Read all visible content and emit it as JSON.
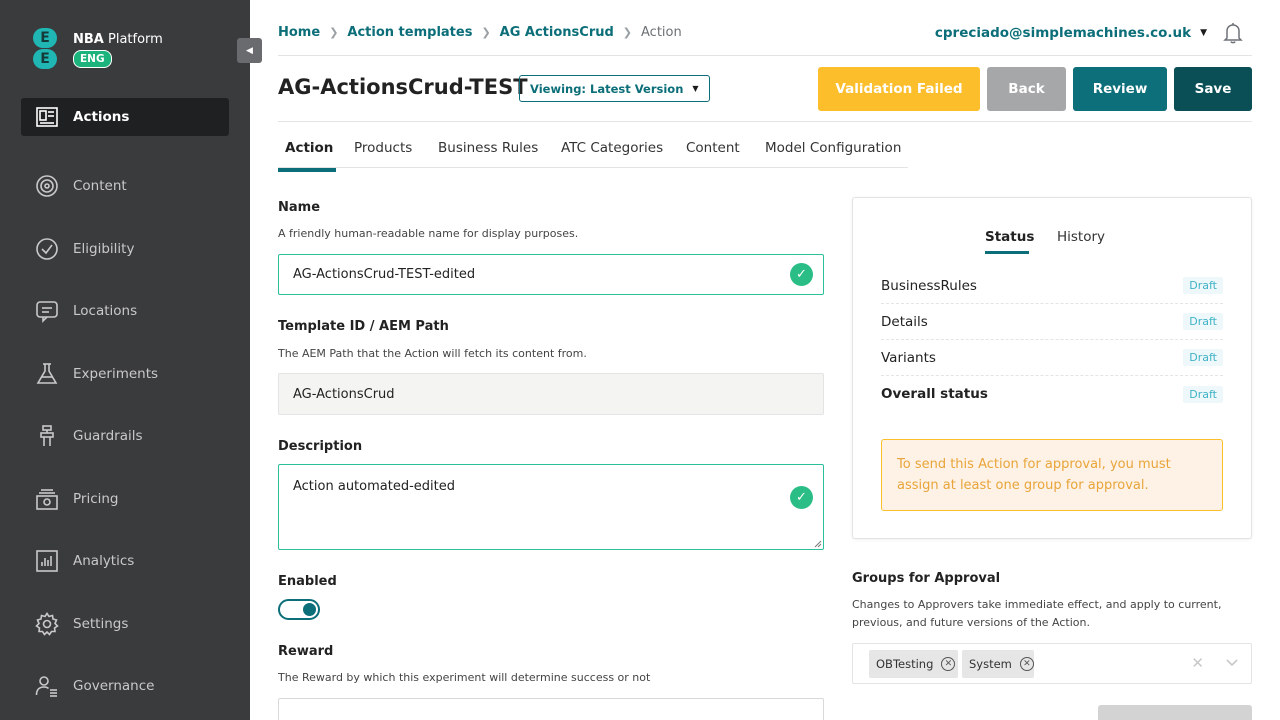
{
  "app": {
    "brand_name_bold": "NBA",
    "brand_name_rest": " Platform",
    "brand_tag": "ENG",
    "brand_logo_letter": "E"
  },
  "sidebar": {
    "items": [
      {
        "label": "Actions",
        "icon": "actions-icon",
        "active": true
      },
      {
        "label": "Content",
        "icon": "content-icon"
      },
      {
        "label": "Eligibility",
        "icon": "eligibility-icon"
      },
      {
        "label": "Locations",
        "icon": "locations-icon"
      },
      {
        "label": "Experiments",
        "icon": "experiments-icon"
      },
      {
        "label": "Guardrails",
        "icon": "guardrails-icon"
      },
      {
        "label": "Pricing",
        "icon": "pricing-icon"
      },
      {
        "label": "Analytics",
        "icon": "analytics-icon"
      },
      {
        "label": "Settings",
        "icon": "settings-icon"
      },
      {
        "label": "Governance",
        "icon": "governance-icon"
      }
    ]
  },
  "breadcrumb": {
    "home": "Home",
    "templates": "Action templates",
    "crud": "AG ActionsCrud",
    "current": "Action"
  },
  "user": {
    "email": "cpreciado@simplemachines.co.uk"
  },
  "header": {
    "title": "AG-ActionsCrud-TEST",
    "version_label": "Viewing: Latest Version",
    "validation_label": "Validation Failed",
    "back_label": "Back",
    "review_label": "Review",
    "save_label": "Save",
    "accent_color": "#0b6e78",
    "warning_color": "#fcbf2b"
  },
  "tabs": [
    "Action",
    "Products",
    "Business Rules",
    "ATC Categories",
    "Content",
    "Model Configuration"
  ],
  "form": {
    "name_label": "Name",
    "name_help": "A friendly human-readable name for display purposes.",
    "name_value": "AG-ActionsCrud-TEST-edited",
    "template_label": "Template ID / AEM Path",
    "template_help": "The AEM Path that the Action will fetch its content from.",
    "template_value": "AG-ActionsCrud",
    "description_label": "Description",
    "description_value": "Action automated-edited",
    "enabled_label": "Enabled",
    "enabled_value": true,
    "reward_label": "Reward",
    "reward_help": "The Reward by which this experiment will determine success or not"
  },
  "status_panel": {
    "tab_status": "Status",
    "tab_history": "History",
    "rows": [
      {
        "label": "BusinessRules",
        "status": "Draft"
      },
      {
        "label": "Details",
        "status": "Draft"
      },
      {
        "label": "Variants",
        "status": "Draft"
      },
      {
        "label": "Overall status",
        "status": "Draft"
      }
    ],
    "warning": "To send this Action for approval, you must assign at least one group for approval."
  },
  "groups": {
    "title": "Groups for Approval",
    "help": "Changes to Approvers take immediate effect, and apply to current, previous, and future versions of the Action.",
    "chips": [
      "OBTesting",
      "System"
    ]
  }
}
